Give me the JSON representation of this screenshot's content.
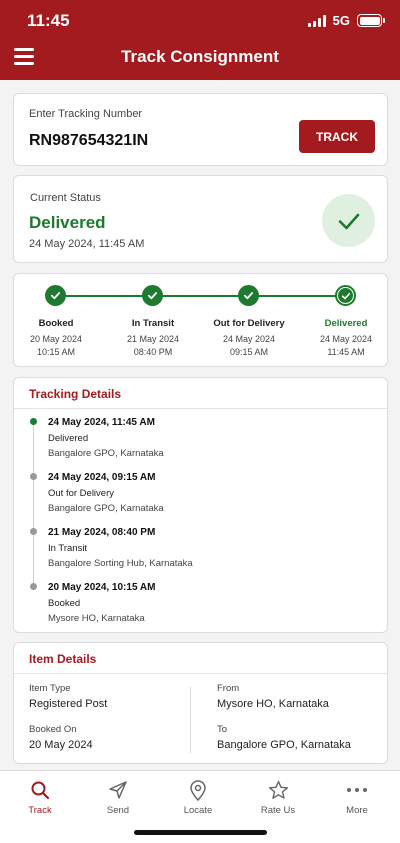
{
  "status_bar": {
    "time": "11:45",
    "network": "5G"
  },
  "header": {
    "title": "Track Consignment",
    "menu_icon": "hamburger-menu-icon"
  },
  "tracking_input": {
    "label": "Enter Tracking Number",
    "value": "RN987654321IN",
    "button_label": "TRACK"
  },
  "current_status": {
    "label": "Current Status",
    "status": "Delivered",
    "datetime": "24 May 2024, 11:45 AM",
    "icon": "check-icon"
  },
  "progress": {
    "steps": [
      {
        "name": "Booked",
        "date": "20 May 2024",
        "time": "10:15 AM"
      },
      {
        "name": "In Transit",
        "date": "21 May 2024",
        "time": "08:40 PM"
      },
      {
        "name": "Out for Delivery",
        "date": "24 May 2024",
        "time": "09:15 AM"
      },
      {
        "name": "Delivered",
        "date": "24 May 2024",
        "time": "11:45 AM"
      }
    ]
  },
  "tracking_details": {
    "title": "Tracking Details",
    "events": [
      {
        "datetime": "24 May 2024, 11:45 AM",
        "status": "Delivered",
        "location": "Bangalore GPO, Karnataka"
      },
      {
        "datetime": "24 May 2024, 09:15 AM",
        "status": "Out for Delivery",
        "location": "Bangalore GPO, Karnataka"
      },
      {
        "datetime": "21 May 2024, 08:40 PM",
        "status": "In Transit",
        "location": "Bangalore Sorting Hub, Karnataka"
      },
      {
        "datetime": "20 May 2024, 10:15 AM",
        "status": "Booked",
        "location": "Mysore HO, Karnataka"
      }
    ]
  },
  "item_details": {
    "title": "Item Details",
    "item_type_label": "Item Type",
    "item_type": "Registered Post",
    "booked_on_label": "Booked On",
    "booked_on": "20 May 2024",
    "from_label": "From",
    "from": "Mysore HO, Karnataka",
    "to_label": "To",
    "to": "Bangalore GPO, Karnataka"
  },
  "tabbar": {
    "tabs": [
      {
        "label": "Track",
        "icon": "search-icon",
        "active": true
      },
      {
        "label": "Send",
        "icon": "send-icon",
        "active": false
      },
      {
        "label": "Locate",
        "icon": "location-pin-icon",
        "active": false
      },
      {
        "label": "Rate Us",
        "icon": "star-icon",
        "active": false
      },
      {
        "label": "More",
        "icon": "more-dots-icon",
        "active": false
      }
    ]
  },
  "colors": {
    "brand": "#a31a1f",
    "success": "#1e7a2e",
    "success_bg": "#dff0e0"
  }
}
